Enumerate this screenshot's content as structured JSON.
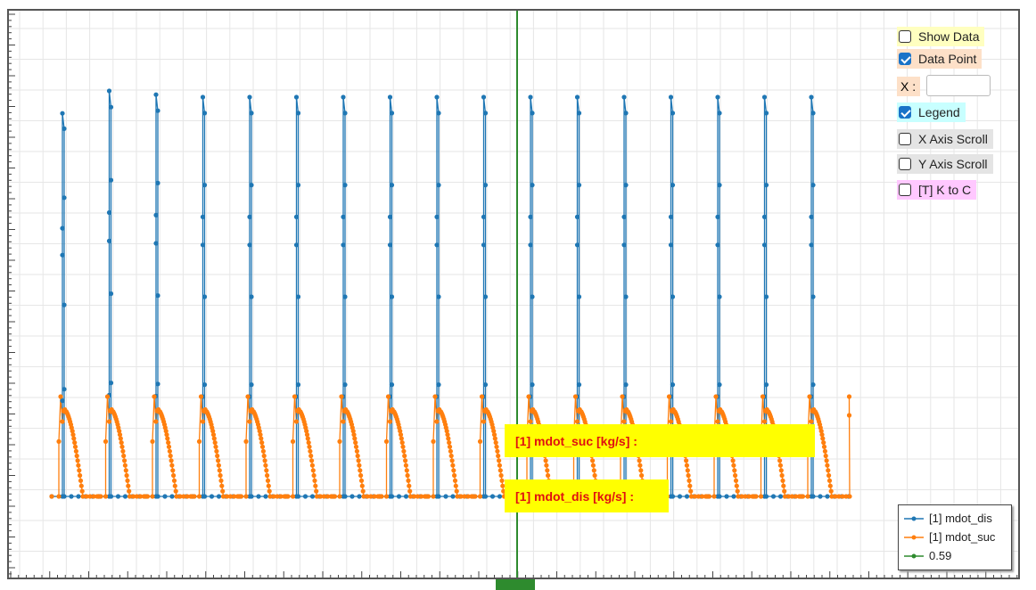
{
  "controls": {
    "show_data": {
      "label": "Show Data",
      "checked": false,
      "bg": "#ffffc0"
    },
    "data_point": {
      "label": "Data Point",
      "checked": true,
      "bg": "#fde0c8"
    },
    "x_label": "X :",
    "x_value": "",
    "legend": {
      "label": "Legend",
      "checked": true,
      "bg": "#c8ffff"
    },
    "x_axis_scroll": {
      "label": "X Axis Scroll",
      "checked": false,
      "bg": "#e4e4e4"
    },
    "y_axis_scroll": {
      "label": "Y Axis Scroll",
      "checked": false,
      "bg": "#e4e4e4"
    },
    "k_to_c": {
      "label": "[T] K to C",
      "checked": false,
      "bg": "#ffc8ff"
    }
  },
  "tooltips": {
    "suc": "[1] mdot_suc [kg/s] :",
    "dis": "[1] mdot_dis [kg/s] :"
  },
  "chart_data": {
    "type": "line",
    "title": "",
    "xlabel": "",
    "ylabel": "",
    "grid": true,
    "legend_placement": "bottom-right",
    "cursor_x": 0.59,
    "series": [
      {
        "name": "[1] mdot_dis",
        "color": "#1f77b4",
        "pulse_peaks": [
          3.07,
          3.25,
          3.22,
          3.2,
          3.2,
          3.2,
          3.2,
          3.2,
          3.2,
          3.2,
          3.2,
          3.2,
          3.2,
          3.2,
          3.2,
          3.2,
          3.2
        ]
      },
      {
        "name": "[1] mdot_suc",
        "color": "#ff7f0e",
        "pulse_peak": 0.8,
        "plateau": 0.7
      },
      {
        "name": "0.59",
        "color": "#2e8b2e"
      }
    ],
    "cycles": 17
  },
  "legend": {
    "items": [
      {
        "label": "[1] mdot_dis",
        "color": "#1f77b4"
      },
      {
        "label": "[1] mdot_suc",
        "color": "#ff7f0e"
      },
      {
        "label": "0.59",
        "color": "#2e8b2e"
      }
    ]
  }
}
